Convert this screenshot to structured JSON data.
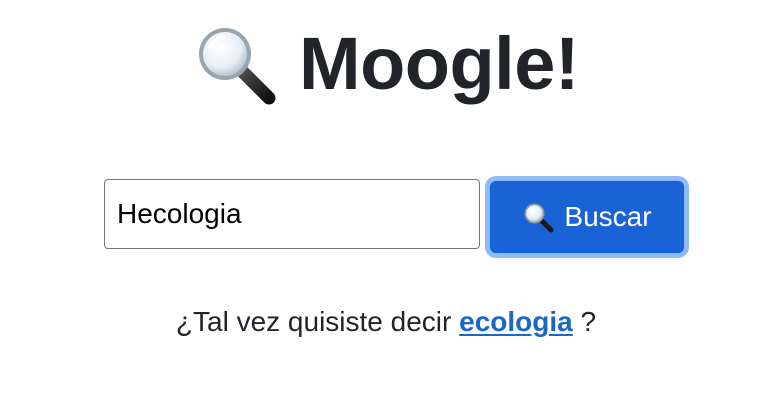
{
  "header": {
    "title": "Moogle!",
    "icon": "magnifying-glass-icon"
  },
  "search": {
    "value": "Hecologia",
    "placeholder": "",
    "button_label": "Buscar",
    "button_icon": "magnifying-glass-icon"
  },
  "suggestion": {
    "prefix": "¿Tal vez quisiste decir",
    "link_text": "ecologia",
    "suffix": "?"
  },
  "colors": {
    "button_bg": "#1a63d6",
    "button_focus_ring": "#8fb9f7",
    "link": "#1a66c9",
    "text": "#212529"
  }
}
